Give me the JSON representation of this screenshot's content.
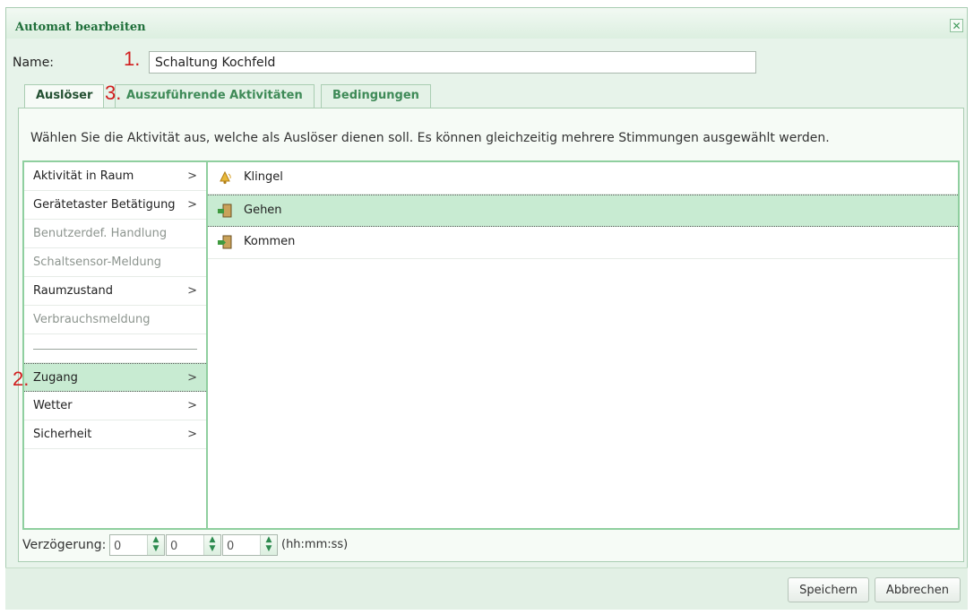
{
  "dialog": {
    "title": "Automat bearbeiten",
    "close_symbol": "✕"
  },
  "name_field": {
    "label": "Name:",
    "value": "Schaltung Kochfeld"
  },
  "markers": {
    "m1": "1.",
    "m2": "2.",
    "m3": "3."
  },
  "tabs": [
    {
      "label": "Auslöser",
      "active": true
    },
    {
      "label": "Auszuführende Aktivitäten",
      "active": false
    },
    {
      "label": "Bedingungen",
      "active": false
    }
  ],
  "instructions": "Wählen Sie die Aktivität aus, welche als Auslöser dienen soll. Es können gleichzeitig mehrere Stimmungen ausgewählt werden.",
  "categories": [
    {
      "label": "Aktivität in Raum",
      "chevron": ">"
    },
    {
      "label": "Gerätetaster Betätigung",
      "chevron": ">"
    },
    {
      "label": "Benutzerdef. Handlung",
      "chevron": ""
    },
    {
      "label": "Schaltsensor-Meldung",
      "chevron": ""
    },
    {
      "label": "Raumzustand",
      "chevron": ">"
    },
    {
      "label": "Verbrauchsmeldung",
      "chevron": ""
    },
    {
      "label": "Zugang",
      "chevron": ">"
    },
    {
      "label": "Wetter",
      "chevron": ">"
    },
    {
      "label": "Sicherheit",
      "chevron": ">"
    }
  ],
  "events": [
    {
      "label": "Klingel",
      "icon": "bell-icon"
    },
    {
      "label": "Gehen",
      "icon": "door-exit-icon"
    },
    {
      "label": "Kommen",
      "icon": "door-enter-icon"
    }
  ],
  "delay": {
    "label": "Verzögerung:",
    "hours": "0",
    "minutes": "0",
    "seconds": "0",
    "format": "(hh:mm:ss)"
  },
  "buttons": {
    "save": "Speichern",
    "cancel": "Abbrechen"
  },
  "colors": {
    "accent": "#1f6f3a",
    "selection": "#c8ebd2",
    "marker": "#d11d1d"
  }
}
